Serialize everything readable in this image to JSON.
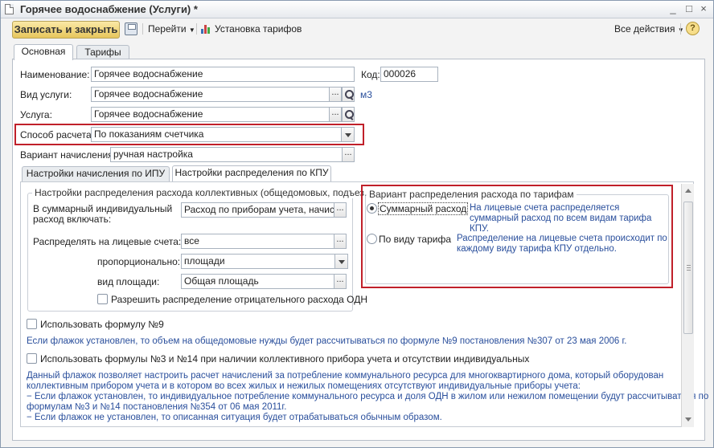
{
  "window": {
    "title": "Горячее водоснабжение (Услуги) *",
    "controls": [
      "_",
      "□",
      "×"
    ]
  },
  "toolbar": {
    "save_close": "Записать и закрыть",
    "go": "Перейти",
    "tariffs": "Установка тарифов",
    "all_actions": "Все действия",
    "help": "?"
  },
  "tabs": [
    "Основная",
    "Тарифы"
  ],
  "form": {
    "name_label": "Наименование:",
    "name_value": "Горячее водоснабжение",
    "code_label": "Код:",
    "code_value": "000026",
    "service_type_label": "Вид услуги:",
    "service_type_value": "Горячее водоснабжение",
    "unit": "м3",
    "service_label": "Услуга:",
    "service_value": "Горячее водоснабжение",
    "calc_method_label": "Способ расчета:",
    "calc_method_value": "По показаниям счетчика",
    "accrual_variant_label": "Вариант начисления:",
    "accrual_variant_value": "ручная настройка"
  },
  "subtabs": [
    "Настройки начисления по ИПУ",
    "Настройки распределения по КПУ"
  ],
  "distribution": {
    "group_title": "Настройки распределения расхода коллективных (общедомовых, подъез...",
    "include_label": "В суммарный индивидуальный расход включать:",
    "include_value": "Расход по приборам учета, начислен",
    "distribute_label": "Распределять на лицевые счета:",
    "distribute_value": "все",
    "proportional_label": "пропорционально:",
    "proportional_value": "площади",
    "area_type_label": "вид площади:",
    "area_type_value": "Общая площадь",
    "allow_negative": "Разрешить распределение отрицательного расхода ОДН"
  },
  "tariff_variant": {
    "group_title": "Вариант распределения расхода по тарифам",
    "option1": "Суммарный расход",
    "option1_note": "На лицевые счета распределяется суммарный расход по всем видам тарифа КПУ.",
    "option2": "По виду тарифа",
    "option2_note": "Распределение на лицевые счета происходит по каждому виду тарифа КПУ отдельно."
  },
  "formula9": {
    "label": "Использовать формулу №9",
    "note": "Если флажок установлен, то объем на общедомовые нужды будет рассчитываться по формуле №9 постановления №307 от 23 мая 2006 г."
  },
  "formula3_14": {
    "label": "Использовать формулы №3 и №14 при наличии коллективного прибора учета и отсутствии индивидуальных",
    "note_lines": [
      "Данный флажок позволяет настроить расчет начислений за потребление коммунального ресурса для многоквартирного дома, который оборудован",
      "коллективным прибором учета и в котором во всех жилых и нежилых помещениях отсутствуют индивидуальные приборы учета:",
      "− Если флажок установлен, то индивидуальное потребление коммунального ресурса и доля ОДН в жилом или нежилом помещении будут рассчитываться по",
      "формулам №3 и №14 постановления №354 от 06 мая 2011г.",
      "− Если флажок не установлен, то описанная ситуация будет отрабатываться обычным образом."
    ]
  },
  "colors": {
    "accent_button": "#e7c65c",
    "highlight_border": "#c0202a",
    "note_text": "#2a4f9c"
  }
}
